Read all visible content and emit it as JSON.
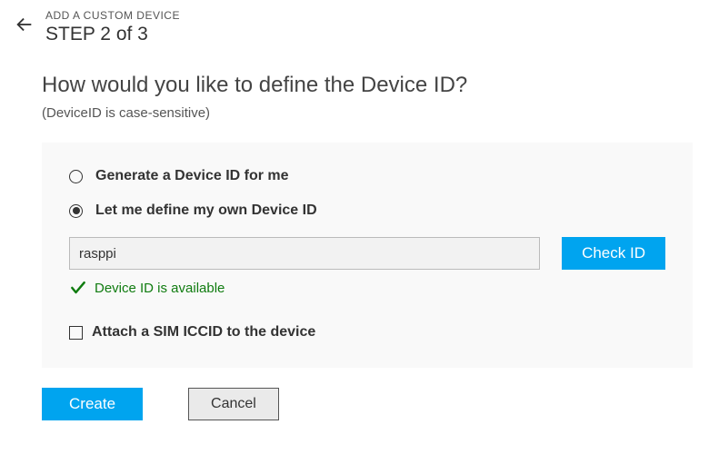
{
  "header": {
    "breadcrumb": "ADD A CUSTOM DEVICE",
    "step": "STEP 2 of 3"
  },
  "question": "How would you like to define the Device ID?",
  "note": "(DeviceID is case-sensitive)",
  "options": {
    "generate": "Generate a Device ID for me",
    "define": "Let me define my own Device ID"
  },
  "input": {
    "value": "rasppi"
  },
  "check_button": "Check ID",
  "status": "Device ID is available",
  "sim_label": "Attach a SIM ICCID to the device",
  "buttons": {
    "create": "Create",
    "cancel": "Cancel"
  }
}
